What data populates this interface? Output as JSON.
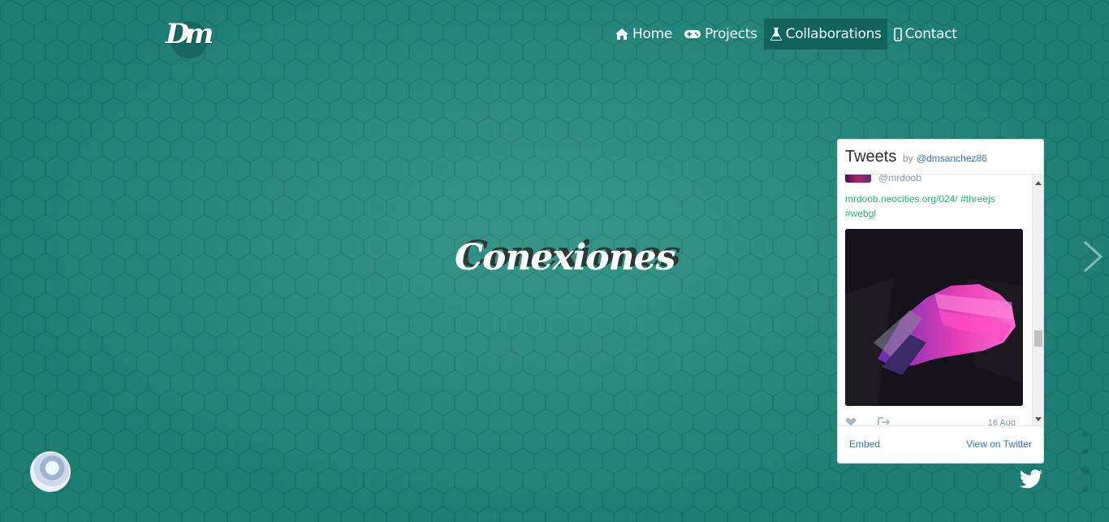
{
  "logo": {
    "text": "Dm"
  },
  "nav": {
    "items": [
      {
        "label": "Home",
        "icon": "home-icon",
        "active": false
      },
      {
        "label": "Projects",
        "icon": "gamepad-icon",
        "active": false
      },
      {
        "label": "Collaborations",
        "icon": "flask-icon",
        "active": true
      },
      {
        "label": "Contact",
        "icon": "mobile-icon",
        "active": false
      }
    ]
  },
  "hero": {
    "title": "Conexiones"
  },
  "tweets_widget": {
    "title": "Tweets",
    "by": "by",
    "handle": "@dmsanchez86",
    "tweet": {
      "user": "@mrdoob",
      "link_text": "mrdoob.neocities.org/024/ #threejs #webgl",
      "date": "16 Aug"
    },
    "embed_label": "Embed",
    "view_label": "View on Twitter"
  },
  "colors": {
    "background": "#1f8a7c",
    "nav_active": "#11645a",
    "link_blue": "#2b7bb9",
    "link_green": "#1fb56e"
  }
}
